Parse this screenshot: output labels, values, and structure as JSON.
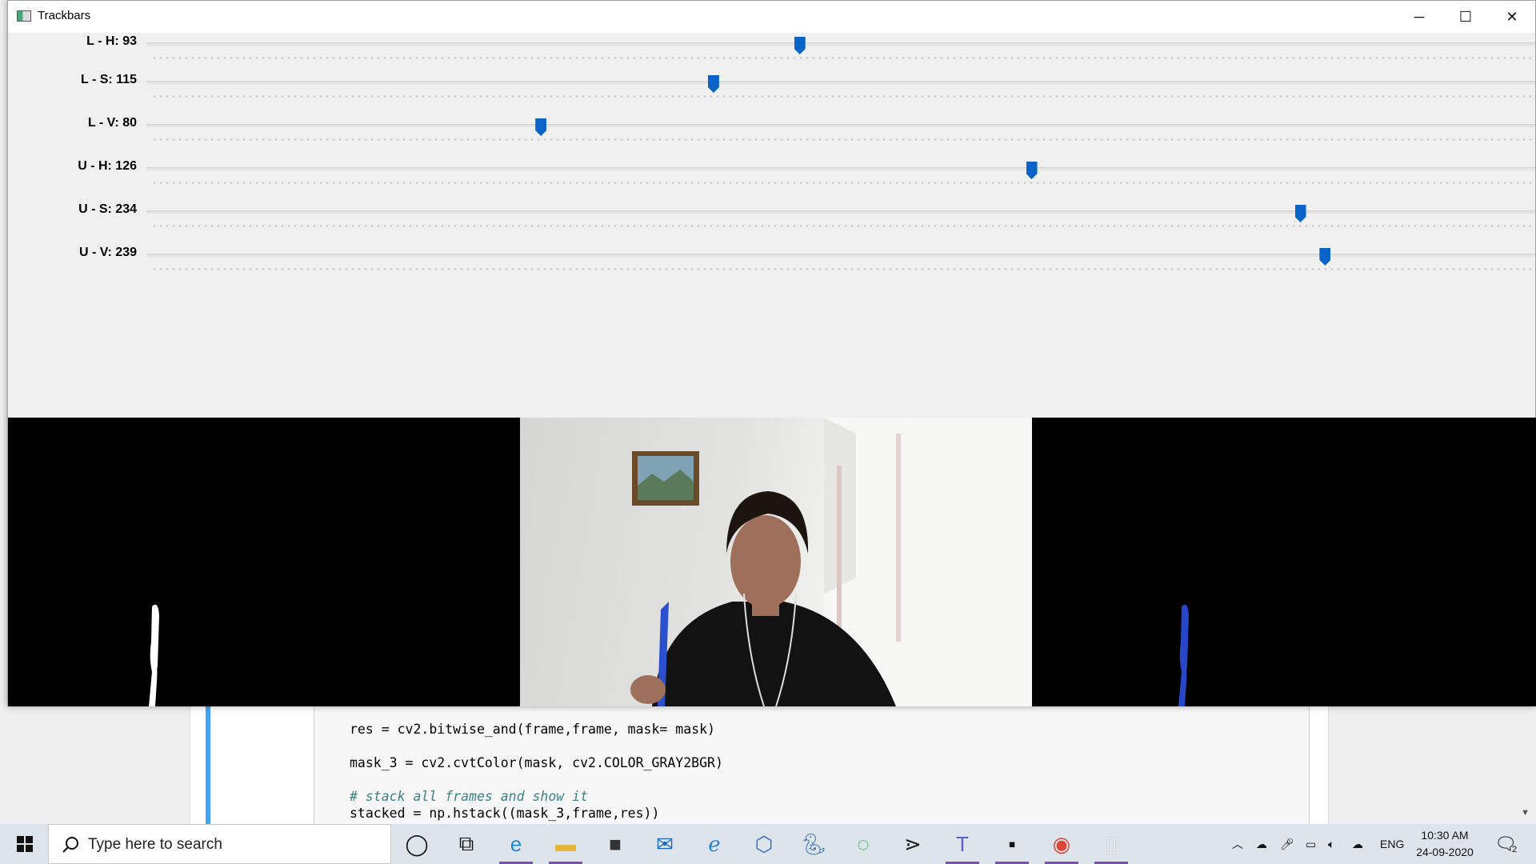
{
  "window": {
    "title": "Trackbars",
    "minimize_glyph": "─",
    "maximize_glyph": "☐",
    "close_glyph": "✕"
  },
  "trackbars": [
    {
      "label": "L - H: 93",
      "value": 93,
      "max": 179
    },
    {
      "label": "L - S: 115",
      "value": 115,
      "max": 255
    },
    {
      "label": "L - V: 80",
      "value": 80,
      "max": 255
    },
    {
      "label": "U - H: 126",
      "value": 126,
      "max": 179
    },
    {
      "label": "U - S: 234",
      "value": 234,
      "max": 255
    },
    {
      "label": "U - V: 239",
      "value": 239,
      "max": 255
    }
  ],
  "notebook": {
    "lines": [
      "res = cv2.bitwise_and(frame,frame, mask= mask)",
      "mask_3 = cv2.cvtColor(mask, cv2.COLOR_GRAY2BGR)",
      "# stack all frames and show it",
      "stacked = np.hstack((mask_3,frame,res))"
    ]
  },
  "taskbar": {
    "search_placeholder": "Type here to search",
    "language": "ENG",
    "time": "10:30 AM",
    "date": "24-09-2020",
    "notification_count": "2",
    "icons": [
      "cortana-icon",
      "task-view-icon",
      "edge-icon",
      "file-explorer-icon",
      "store-icon",
      "mail-icon",
      "internet-explorer-icon",
      "3d-viewer-icon",
      "python-icon",
      "app-icon",
      "terminal-app-icon",
      "teams-icon",
      "command-prompt-icon",
      "chrome-icon",
      "notepad-icon"
    ]
  },
  "colors": {
    "thumb": "#0a63c9",
    "taskbar": "#dde4ec",
    "accent": "#7a4fb0"
  }
}
